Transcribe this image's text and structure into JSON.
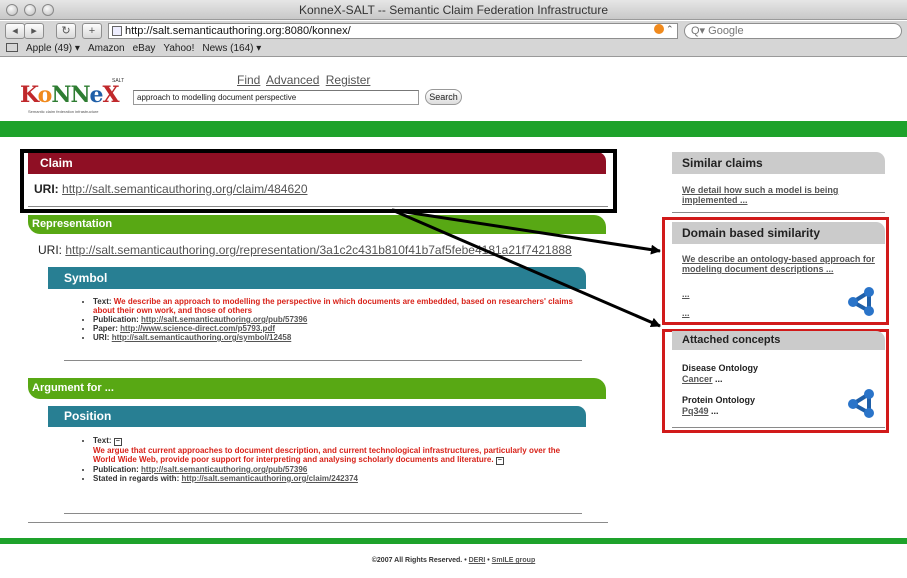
{
  "window": {
    "title": "KonneX-SALT -- Semantic Claim Federation Infrastructure"
  },
  "toolbar": {
    "url": "http://salt.semanticauthoring.org:8080/konnex/",
    "search_placeholder": "Google"
  },
  "bookmarks": [
    "Apple (49) ▾",
    "Amazon",
    "eBay",
    "Yahoo!",
    "News (164) ▾"
  ],
  "header": {
    "logo_text": "KoNNeX",
    "logo_sup": "SALT",
    "logo_tagline": "Semantic claim federation infrastructure",
    "nav": [
      "Find",
      "Advanced",
      "Register"
    ],
    "search_value": "approach to modelling document perspective",
    "search_button": "Search"
  },
  "claim": {
    "heading": "Claim",
    "uri_label": "URI:",
    "uri": "http://salt.semanticauthoring.org/claim/484620"
  },
  "representation": {
    "heading": "Representation",
    "uri_label": "URI:",
    "uri": "http://salt.semanticauthoring.org/representation/3a1c2c431b810f41b7af5febe4181a21f7421888"
  },
  "symbol": {
    "heading": "Symbol",
    "text_label": "Text:",
    "text": "We describe an approach to modelling the perspective in which documents are embedded, based on researchers' claims about their own work, and those of others",
    "publication_label": "Publication:",
    "publication": "http://salt.semanticauthoring.org/pub/57396",
    "paper_label": "Paper:",
    "paper": "http://www.science-direct.com/p5793.pdf",
    "uri_label": "URI:",
    "uri": "http://salt.semanticauthoring.org/symbol/12458"
  },
  "argument": {
    "heading": "Argument for ..."
  },
  "position": {
    "heading": "Position",
    "text_label": "Text:",
    "text": "We argue that current approaches to document description, and current technological infrastructures, particularly over the World Wide Web, provide poor support for interpreting and analysing scholarly documents and literature.",
    "publication_label": "Publication:",
    "publication": "http://salt.semanticauthoring.org/pub/57396",
    "regards_label": "Stated in regards with:",
    "regards": "http://salt.semanticauthoring.org/claim/242374"
  },
  "sidebar": {
    "similar_heading": "Similar claims",
    "similar_link": "We detail how such a model is being implemented ...",
    "domain_heading": "Domain based similarity",
    "domain_link": "We describe an ontology-based approach for modeling document descriptions ...",
    "domain_more_1": "...",
    "domain_more_2": "...",
    "concepts_heading": "Attached concepts",
    "concept_1_name": "Disease Ontology",
    "concept_1_link": "Cancer",
    "concept_1_more": " ...",
    "concept_2_name": "Protein Ontology",
    "concept_2_link": "Pq349",
    "concept_2_more": " ..."
  },
  "footer": {
    "copyright": "©2007 All Rights Reserved.",
    "sep": " • ",
    "link_1": "DERI",
    "link_2": "SmILE group"
  },
  "colors": {
    "claim": "#8f0f24",
    "green": "#58a814",
    "teal": "#287f93",
    "band": "#1ea22b",
    "highlight_red": "#d11a1a",
    "text_red": "#d8231a"
  },
  "icons": [
    "back-arrow-icon",
    "forward-arrow-icon",
    "reload-icon",
    "add-bookmark-icon",
    "rss-icon",
    "molecule-icon"
  ]
}
